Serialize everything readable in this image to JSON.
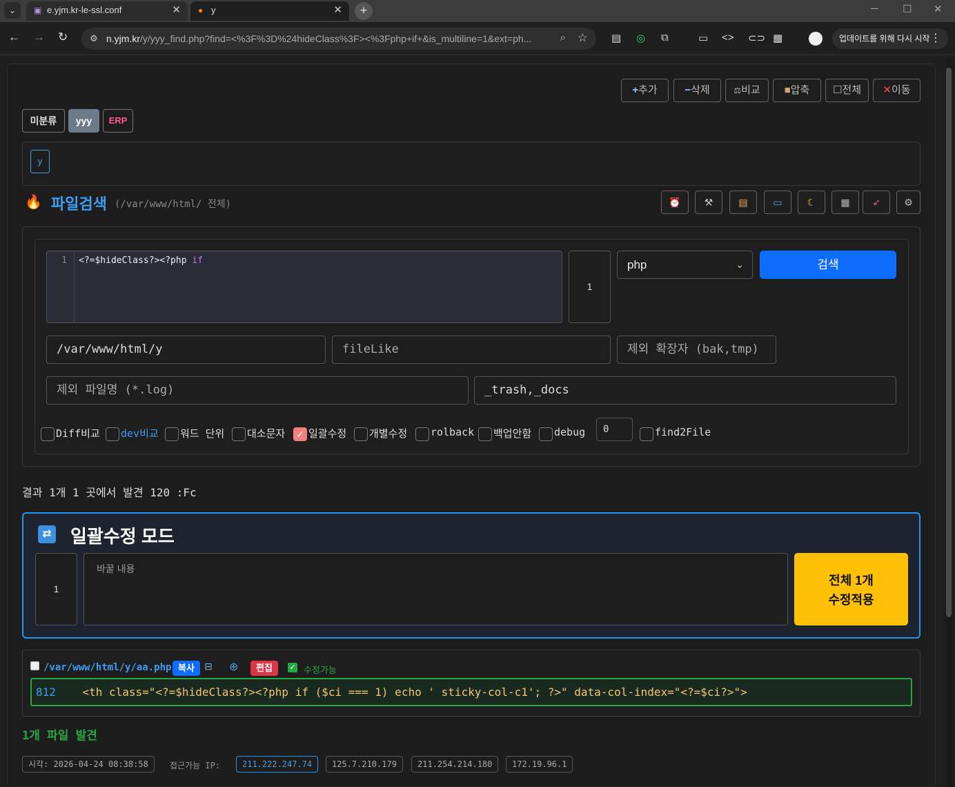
{
  "browser": {
    "tabs": [
      {
        "label": "e.yjm.kr-le-ssl.conf",
        "close": "✕"
      },
      {
        "label": "y",
        "close": "✕"
      }
    ],
    "url_host": "n.yjm.kr",
    "url_path": "/y/yyy_find.php?find=<%3F%3D%24hideClass%3F><%3Fphp+if+&is_multiline=1&ext=ph...",
    "update_button": "업데이트를 위해 다시 시작"
  },
  "actions": {
    "add": "추가",
    "delete": "삭제",
    "compare": "비교",
    "compress": "압축",
    "all": "전체",
    "move": "이동"
  },
  "categories": [
    {
      "label": "미분류"
    },
    {
      "label": "yyy"
    },
    {
      "label": "ERP"
    }
  ],
  "subcategory": "y",
  "header": {
    "title": "파일검색",
    "subtitle": "(/var/www/html/ 전체)"
  },
  "search": {
    "line_number": "1",
    "code_prefix": "<?=$hideClass?><?php ",
    "code_keyword": "if",
    "line_count": "1",
    "ext_selected": "php",
    "search_button": "검색",
    "path": "/var/www/html/y",
    "filelike_placeholder": "fileLike",
    "exclude_ext_placeholder": "제외 확장자 (bak,tmp)",
    "exclude_name_placeholder": "제외 파일명 (*.log)",
    "exclude_dirs": "_trash,_docs",
    "debug_value": "0"
  },
  "options": [
    {
      "label": "Diff비교",
      "checked": false
    },
    {
      "label": "dev비교",
      "checked": false
    },
    {
      "label": "워드 단위",
      "checked": false
    },
    {
      "label": "대소문자",
      "checked": false
    },
    {
      "label": "일괄수정",
      "checked": true
    },
    {
      "label": "개별수정",
      "checked": false
    },
    {
      "label": "rolback",
      "checked": false
    },
    {
      "label": "백업안함",
      "checked": false
    },
    {
      "label": "debug",
      "checked": false
    },
    {
      "label": "find2File",
      "checked": false
    }
  ],
  "result_summary": "결과 1개 1 곳에서 발견 120 :Fc",
  "bulk": {
    "title": "일괄수정 모드",
    "line_count": "1",
    "replace_placeholder": "바꿀 내용",
    "apply_line1": "전체 1개",
    "apply_line2": "수정적용"
  },
  "result_file": {
    "path": "/var/www/html/y/aa.php",
    "copy": "복사",
    "edit": "편집",
    "editable": "수정가능",
    "line_no": "812",
    "line_text": "<th class=\"<?=$hideClass?><?php if ($ci === 1) echo ' sticky-col-c1'; ?>\" data-col-index=\"<?=$ci?>\">"
  },
  "found_count": "1개 파일 발견",
  "footer": {
    "time": "시각: 2026-04-24 08:38:58",
    "ip_label": "접근가능 IP:",
    "ips": [
      "211.222.247.74",
      "125.7.210.179",
      "211.254.214.180",
      "172.19.96.1"
    ]
  },
  "colors": {
    "accent_blue": "#0d6efd",
    "title_blue": "#3d9df3",
    "warning_yellow": "#ffc107",
    "success_green": "#28a745",
    "danger_red": "#dc3545"
  }
}
